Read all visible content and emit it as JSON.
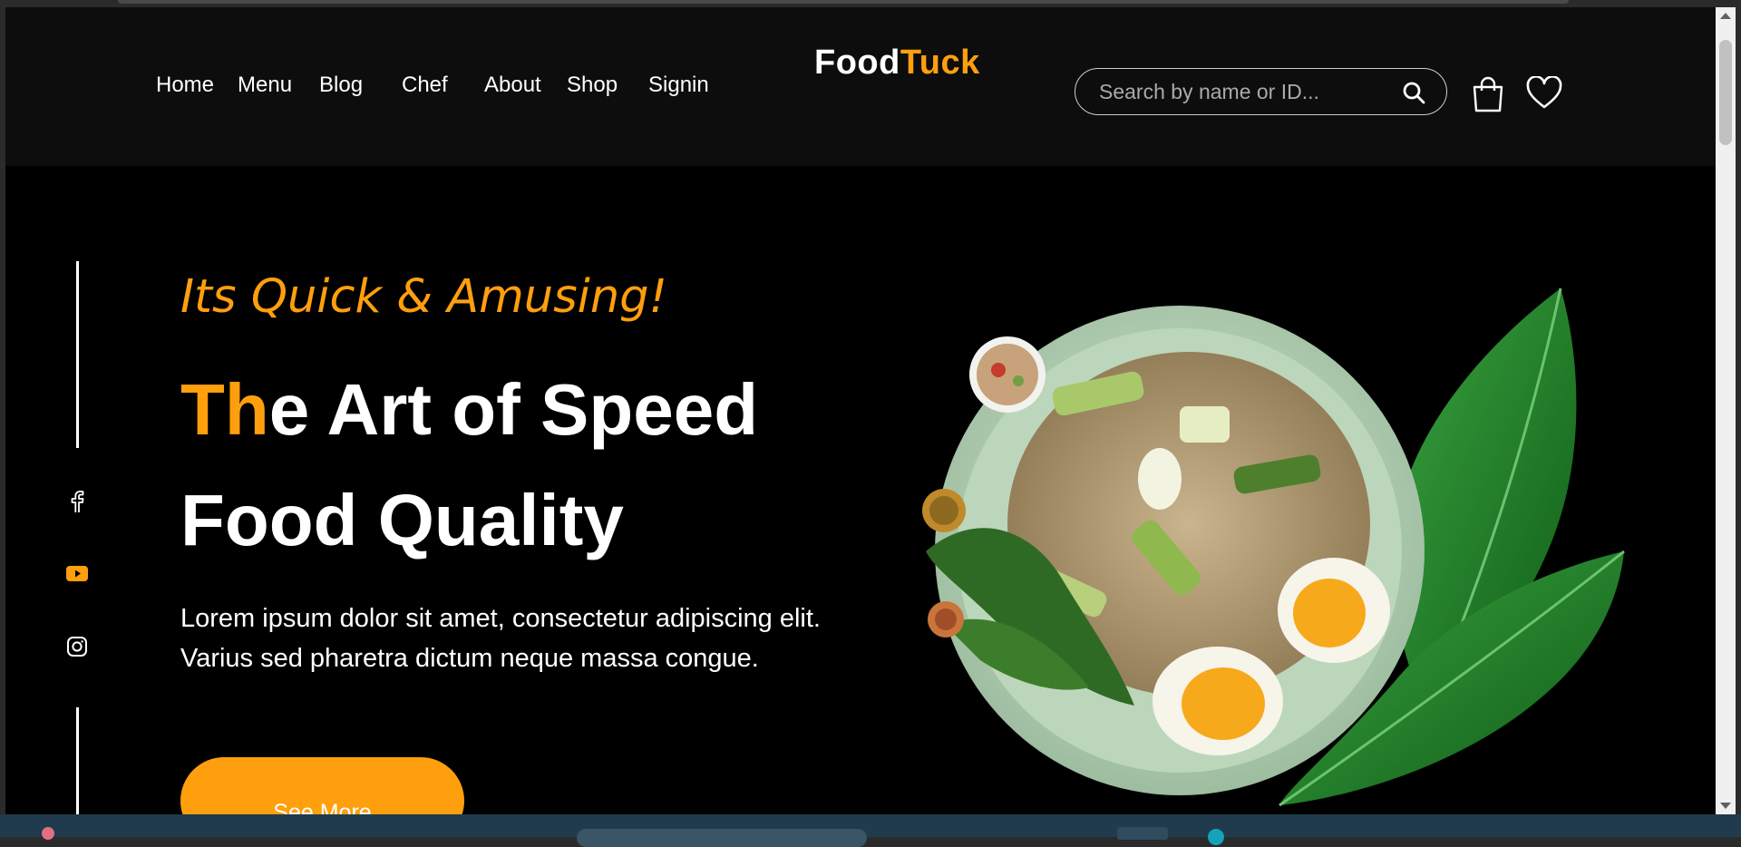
{
  "header": {
    "nav": [
      {
        "label": "Home"
      },
      {
        "label": "Menu"
      },
      {
        "label": "Blog"
      },
      {
        "label": "Chef"
      },
      {
        "label": "About"
      },
      {
        "label": "Shop"
      },
      {
        "label": "Signin"
      }
    ],
    "logo": {
      "part1": "Food",
      "part2": "Tuck"
    },
    "search": {
      "placeholder": "Search by name or ID...",
      "value": ""
    },
    "icons": [
      "search-icon",
      "shopping-bag-icon",
      "heart-icon"
    ]
  },
  "social": {
    "icons": [
      "facebook-icon",
      "youtube-icon",
      "instagram-icon"
    ]
  },
  "hero": {
    "tagline": "Its Quick & Amusing!",
    "headline": {
      "accent": "Th",
      "rest_line1": "e Art of Speed",
      "line2": "Food Quality"
    },
    "description": "Lorem ipsum dolor sit amet, consectetur adipiscing elit. Varius sed pharetra dictum neque massa congue.",
    "cta_label": "See More"
  },
  "colors": {
    "accent": "#ff9f0d",
    "background": "#000000",
    "header_bg": "#0d0d0d",
    "text": "#ffffff"
  }
}
